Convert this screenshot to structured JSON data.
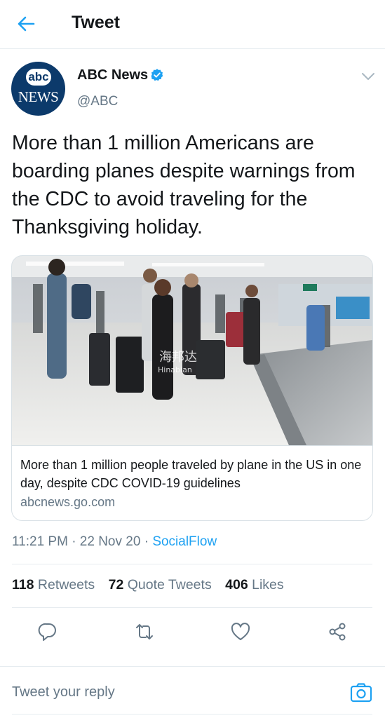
{
  "header": {
    "title": "Tweet",
    "back_icon": "arrow-left-icon"
  },
  "author": {
    "display_name": "ABC News",
    "handle": "@ABC",
    "avatar_top": "abc",
    "avatar_bottom": "NEWS",
    "verified_icon": "verified-badge-icon"
  },
  "tweet": {
    "text": "More than 1 million Americans are boarding planes despite warnings from the CDC to avoid traveling for the Thanksgiving holiday.",
    "time": "11:21 PM · 22 Nov 20 · ",
    "source": "SocialFlow"
  },
  "card": {
    "title": "More than 1 million people traveled by plane in the US in one day, despite CDC COVID-19 guidelines",
    "domain": "abcnews.go.com",
    "watermark_line1": "海邦达",
    "watermark_line2": "Hinabian"
  },
  "stats": {
    "retweets_count": "118",
    "retweets_label": "Retweets",
    "quotes_count": "72",
    "quotes_label": "Quote Tweets",
    "likes_count": "406",
    "likes_label": "Likes"
  },
  "actions": [
    "reply-icon",
    "retweet-icon",
    "like-heart-icon",
    "share-icon"
  ],
  "reply": {
    "placeholder": "Tweet your reply",
    "camera_icon": "camera-icon"
  },
  "colors": {
    "accent": "#1da1f2",
    "text": "#14171a",
    "secondary": "#657786",
    "border": "#e6ecf0"
  }
}
